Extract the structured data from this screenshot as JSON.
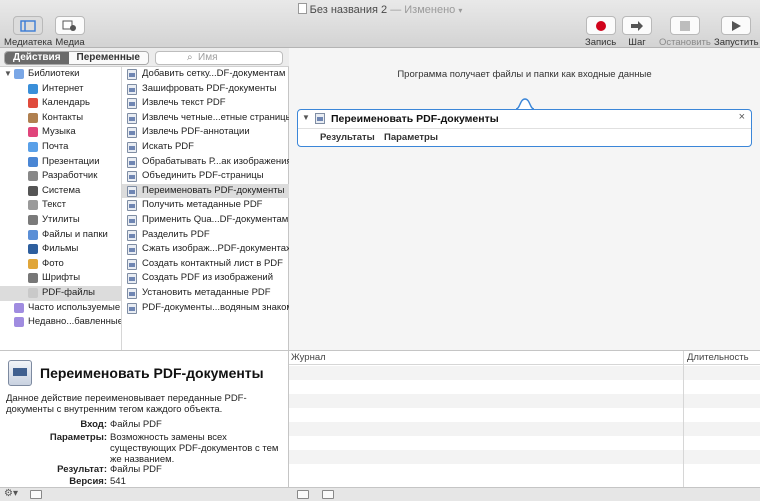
{
  "window": {
    "title": "Без названия 2",
    "status": "— Изменено"
  },
  "toolbar": {
    "library": "Медиатека",
    "media": "Медиа",
    "record": "Запись",
    "step": "Шаг",
    "stop": "Остановить",
    "run": "Запустить"
  },
  "tabs": {
    "actions": "Действия",
    "variables": "Переменные"
  },
  "search": {
    "placeholder": "Имя"
  },
  "library": {
    "root": "Библиотеки",
    "items": [
      {
        "label": "Интернет",
        "color": "#3a8fd9"
      },
      {
        "label": "Календарь",
        "color": "#e04b3c"
      },
      {
        "label": "Контакты",
        "color": "#b08050"
      },
      {
        "label": "Музыка",
        "color": "#e0457b"
      },
      {
        "label": "Почта",
        "color": "#5aa0e8"
      },
      {
        "label": "Презентации",
        "color": "#4a86d4"
      },
      {
        "label": "Разработчик",
        "color": "#888888"
      },
      {
        "label": "Система",
        "color": "#555555"
      },
      {
        "label": "Текст",
        "color": "#9a9a9a"
      },
      {
        "label": "Утилиты",
        "color": "#7a7a7a"
      },
      {
        "label": "Файлы и папки",
        "color": "#5b8fd6"
      },
      {
        "label": "Фильмы",
        "color": "#2e5f9e"
      },
      {
        "label": "Фото",
        "color": "#e0a63a"
      },
      {
        "label": "Шрифты",
        "color": "#777777"
      },
      {
        "label": "PDF-файлы",
        "color": "#c9c9c9"
      }
    ],
    "special": [
      {
        "label": "Часто используемые",
        "color": "#a08ce0"
      },
      {
        "label": "Недавно...бавленные",
        "color": "#a08ce0"
      }
    ]
  },
  "actions": [
    "Добавить сетку...DF-документам",
    "Зашифровать PDF-документы",
    "Извлечь текст PDF",
    "Извлечь четные...етные страницы",
    "Извлечь PDF-аннотации",
    "Искать PDF",
    "Обрабатывать Р...ак изображения",
    "Объединить PDF-страницы",
    "Переименовать PDF-документы",
    "Получить метаданные PDF",
    "Применить Qua...DF-документам",
    "Разделить PDF",
    "Сжать изображ...PDF-документах",
    "Создать контактный лист в PDF",
    "Создать PDF из изображений",
    "Установить метаданные PDF",
    "PDF-документы...водяным знаком"
  ],
  "description": {
    "title": "Переименовать PDF-документы",
    "text": "Данное действие переименовывает переданные PDF-документы с внутренним тегом каждого объекта.",
    "input_label": "Вход:",
    "input_value": "Файлы PDF",
    "params_label": "Параметры:",
    "params_value": "Возможность замены всех существующих PDF-документов с тем же названием.",
    "result_label": "Результат:",
    "result_value": "Файлы PDF",
    "version_label": "Версия:",
    "version_value": "541"
  },
  "workflow": {
    "hint": "Программа получает файлы и папки как входные данные",
    "card_title": "Переименовать PDF-документы",
    "tab_results": "Результаты",
    "tab_params": "Параметры"
  },
  "log": {
    "col_journal": "Журнал",
    "col_duration": "Длительность"
  }
}
